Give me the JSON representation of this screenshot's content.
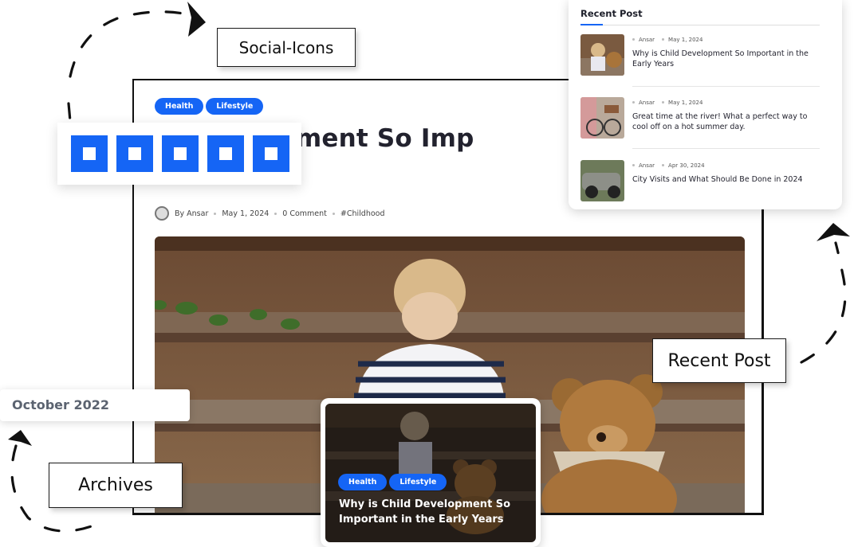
{
  "labels": {
    "social_icons": "Social-Icons",
    "recent_post": "Recent Post",
    "archives": "Archives"
  },
  "article": {
    "tags": [
      "Health",
      "Lifestyle"
    ],
    "title_visible": "d Development So Imp",
    "author": "By Ansar",
    "date": "May 1, 2024",
    "comments": "0 Comment",
    "hashtag": "#Childhood"
  },
  "social": {
    "count": 5,
    "icon": "square-icon",
    "color": "#1565f5"
  },
  "recent": {
    "heading": "Recent Post",
    "posts": [
      {
        "author": "Ansar",
        "date": "May 1, 2024",
        "title": "Why is Child Development So Important in the Early Years"
      },
      {
        "author": "Ansar",
        "date": "May 1, 2024",
        "title": "Great time at the river! What a perfect way to cool off on a hot summer day."
      },
      {
        "author": "Ansar",
        "date": "Apr 30, 2024",
        "title": "City Visits and What Should Be Done in 2024"
      }
    ]
  },
  "archives": {
    "month": "October 2022"
  },
  "overlay": {
    "tags": [
      "Health",
      "Lifestyle"
    ],
    "title": "Why is Child Development So Important in the Early Years"
  },
  "colors": {
    "accent": "#1565f5",
    "text": "#22222e"
  }
}
